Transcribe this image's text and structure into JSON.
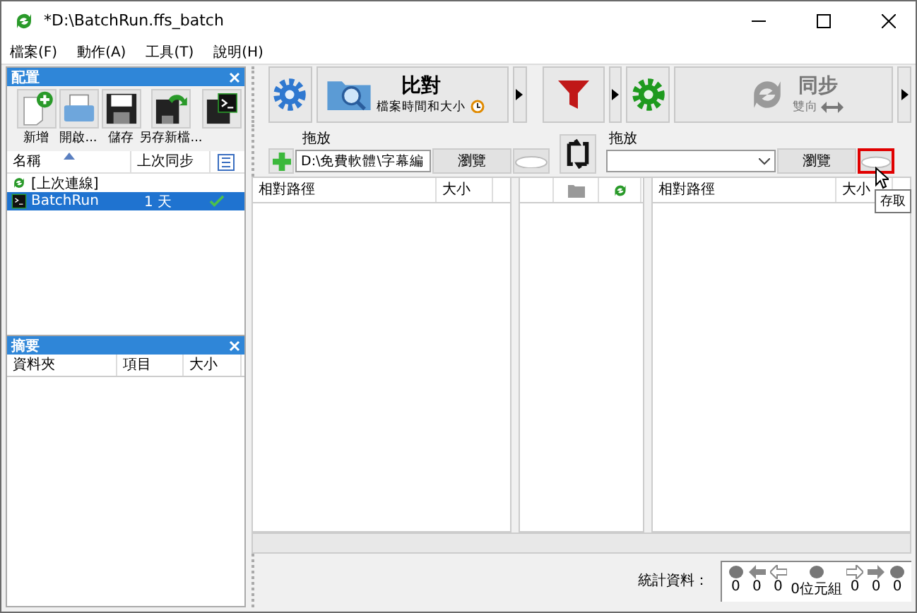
{
  "window": {
    "title": "*D:\\BatchRun.ffs_batch"
  },
  "menu": [
    "檔案(F)",
    "動作(A)",
    "工具(T)",
    "說明(H)"
  ],
  "config_panel": {
    "title": "配置",
    "buttons": [
      {
        "kind": "new",
        "label": "新增"
      },
      {
        "kind": "open",
        "label": "開啟..."
      },
      {
        "kind": "save",
        "label": "儲存"
      },
      {
        "kind": "saveas",
        "label": "另存新檔..."
      },
      {
        "kind": "savebatch"
      }
    ],
    "columns": [
      "名稱",
      "上次同步"
    ],
    "items": [
      {
        "kind": "last",
        "name": "[上次連線]",
        "synced": false,
        "selected": false
      },
      {
        "kind": "batch",
        "name": "BatchRun",
        "last_sync": "1 天",
        "synced": true,
        "selected": true
      }
    ]
  },
  "summary_panel": {
    "title": "摘要",
    "columns": [
      "資料夾",
      "項目",
      "大小"
    ]
  },
  "toolbar": {
    "compare": {
      "title": "比對",
      "subtitle": "檔案時間和大小"
    },
    "sync": {
      "title": "同步",
      "subtitle": "雙向",
      "disabled": true
    }
  },
  "left_folder": {
    "label": "拖放",
    "path": "D:\\免費軟體\\字幕編",
    "browse": "瀏覽"
  },
  "right_folder": {
    "label": "拖放",
    "browse": "瀏覽",
    "cloud_highlighted": true
  },
  "tooltip": "存取",
  "left_grid": {
    "columns": [
      "相對路徑",
      "大小"
    ]
  },
  "right_grid": {
    "columns": [
      "相對路徑",
      "大小"
    ]
  },
  "statistics": {
    "label": "統計資料：",
    "counts": [
      "0",
      "0",
      "0",
      "0位元組",
      "0",
      "0",
      "0"
    ]
  }
}
